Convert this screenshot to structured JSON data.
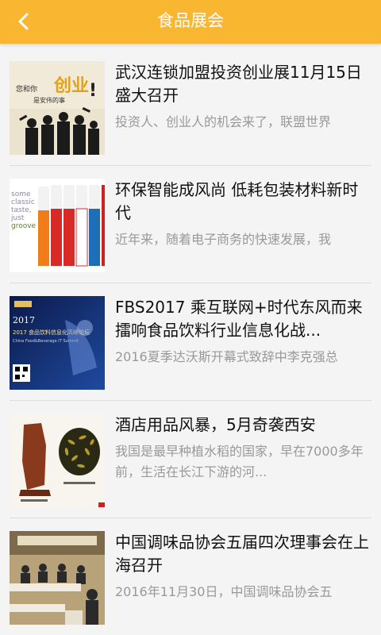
{
  "header": {
    "title": "食品展会",
    "back_icon": "chevron-left-icon",
    "background": "#f9b630"
  },
  "articles": [
    {
      "title": "武汉连锁加盟投资创业展11月15日盛大召开",
      "summary": "投资人、创业人的机会来了，联盟世界",
      "thumb_text": "创业"
    },
    {
      "title": "环保智能成风尚 低耗包装材料新时代",
      "summary": "近年来，随着电子商务的快速发展，我",
      "thumb_text": "some classic taste, just groove"
    },
    {
      "title": "FBS2017 乘互联网+时代东风而来 擂响食品饮料行业信息化战...",
      "summary": "2016夏季达沃斯开幕式致辞中李克强总",
      "thumb_text": "2017 食品饮料信息化高峰论坛"
    },
    {
      "title": "酒店用品风暴，5月奇袭西安",
      "summary": "我国是最早种植水稻的国家，早在7000多年前，生活在长江下游的河...",
      "thumb_text": ""
    },
    {
      "title": "中国调味品协会五届四次理事会在上海召开",
      "summary": "2016年11月30日，中国调味品协会五",
      "thumb_text": ""
    }
  ]
}
